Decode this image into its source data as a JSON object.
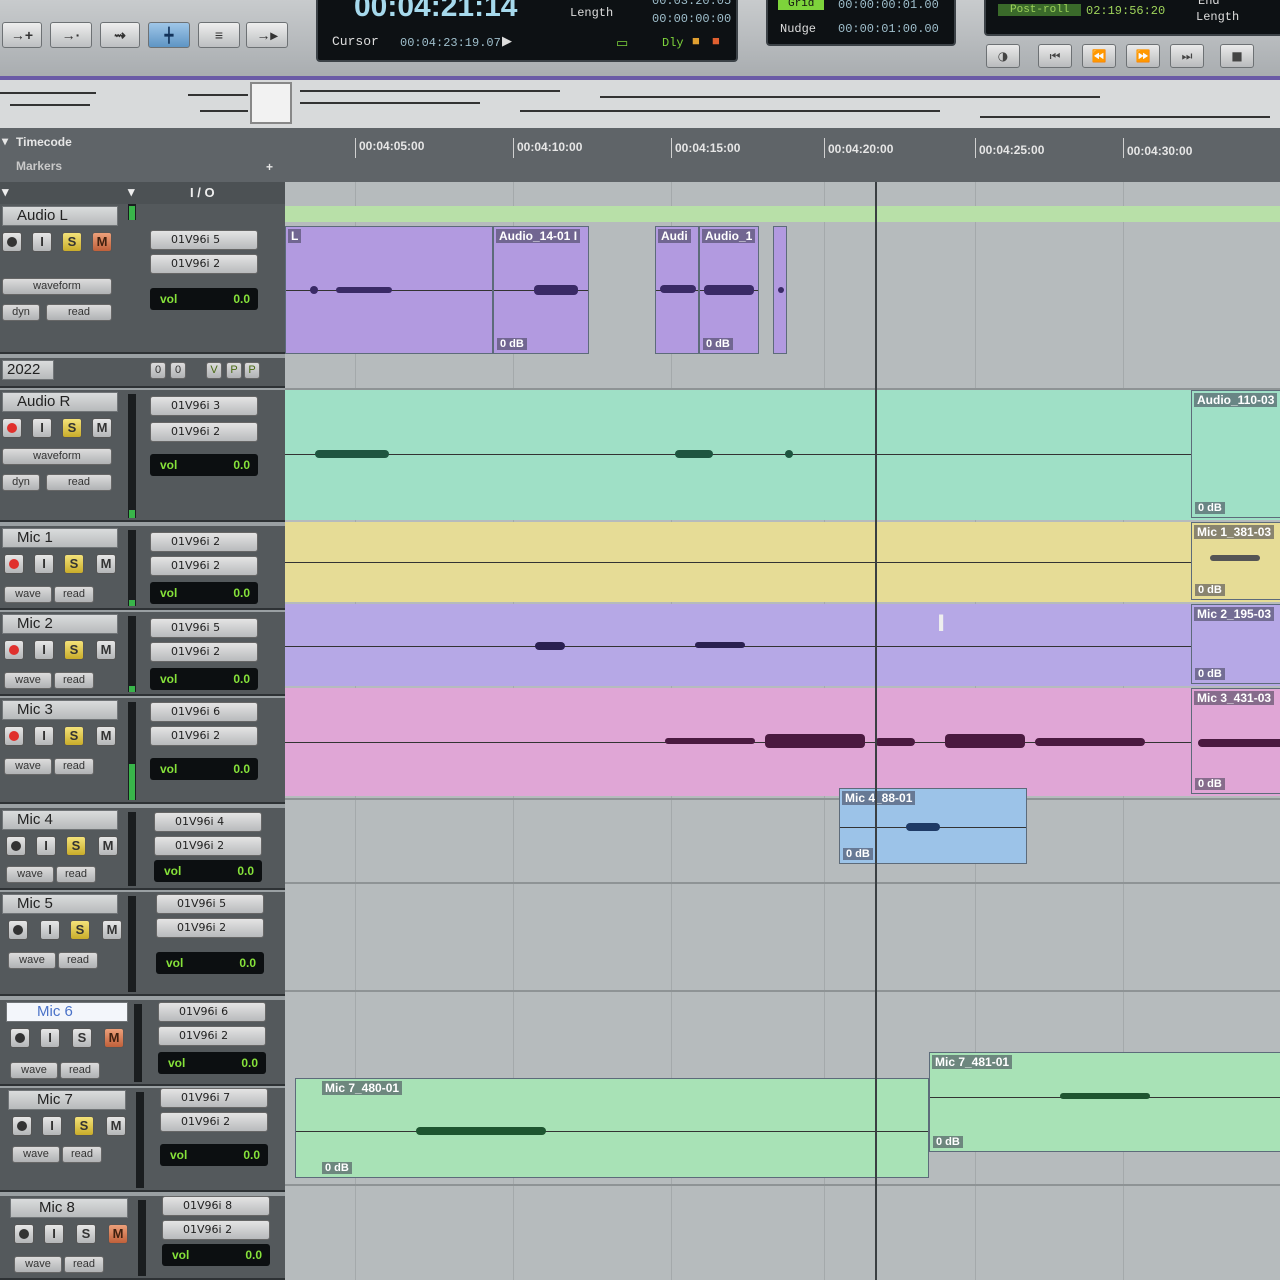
{
  "toolbar": {
    "counter": {
      "main": "00:04:21:14",
      "cursor_label": "Cursor",
      "cursor_value": "00:04:23:19.07",
      "length_label": "Length",
      "end_value": "00:03:20:05",
      "length_value": "00:00:00:00",
      "dly_label": "Dly"
    },
    "grid": {
      "label": "Grid",
      "value": "00:00:00:01.00",
      "nudge_label": "Nudge",
      "nudge_value": "00:00:01:00.00"
    },
    "session": {
      "label": "Post-roll",
      "value": "02:19:56:20",
      "end_label": "End",
      "length_label": "Length"
    }
  },
  "rulers": {
    "timecode_label": "Timecode",
    "markers_label": "Markers",
    "ticks": [
      "00:04:05:00",
      "00:04:10:00",
      "00:04:15:00",
      "00:04:20:00",
      "00:04:25:00",
      "00:04:30:00"
    ]
  },
  "headers": {
    "io": "I / O"
  },
  "tracks": [
    {
      "name": "Audio L",
      "view": "waveform",
      "dyn": "dyn",
      "auto": "read",
      "input": "01V96i 5",
      "output": "01V96i 2",
      "vol_label": "vol",
      "vol": "0.0",
      "armed": false
    },
    {
      "name": "2022",
      "extra": true
    },
    {
      "name": "Audio R",
      "view": "waveform",
      "dyn": "dyn",
      "auto": "read",
      "input": "01V96i 3",
      "output": "01V96i 2",
      "vol_label": "vol",
      "vol": "0.0",
      "armed": true
    },
    {
      "name": "Mic 1",
      "view": "wave",
      "auto": "read",
      "input": "01V96i 2",
      "output": "01V96i 2",
      "vol_label": "vol",
      "vol": "0.0",
      "armed": true
    },
    {
      "name": "Mic 2",
      "view": "wave",
      "auto": "read",
      "input": "01V96i 5",
      "output": "01V96i 2",
      "vol_label": "vol",
      "vol": "0.0",
      "armed": true
    },
    {
      "name": "Mic 3",
      "view": "wave",
      "auto": "read",
      "input": "01V96i 6",
      "output": "01V96i 2",
      "vol_label": "vol",
      "vol": "0.0",
      "armed": true
    },
    {
      "name": "Mic 4",
      "view": "wave",
      "auto": "read",
      "input": "01V96i 4",
      "output": "01V96i 2",
      "vol_label": "vol",
      "vol": "0.0",
      "armed": false
    },
    {
      "name": "Mic 5",
      "view": "wave",
      "auto": "read",
      "input": "01V96i 5",
      "output": "01V96i 2",
      "vol_label": "vol",
      "vol": "0.0",
      "armed": false
    },
    {
      "name": "Mic 6",
      "view": "wave",
      "auto": "read",
      "input": "01V96i 6",
      "output": "01V96i 2",
      "vol_label": "vol",
      "vol": "0.0",
      "armed": false
    },
    {
      "name": "Mic 7",
      "view": "wave",
      "auto": "read",
      "input": "01V96i 7",
      "output": "01V96i 2",
      "vol_label": "vol",
      "vol": "0.0",
      "armed": false
    },
    {
      "name": "Mic 8",
      "view": "wave",
      "auto": "read",
      "input": "01V96i 8",
      "output": "01V96i 2",
      "vol_label": "vol",
      "vol": "0.0",
      "armed": false
    }
  ],
  "extra_row": {
    "a": "0",
    "b": "0",
    "v": "V",
    "p1": "P",
    "p2": "P"
  },
  "clips": {
    "audio_l_1": {
      "name": "L",
      "gain": ""
    },
    "audio_l_2": {
      "name": "Audio_14-01 I",
      "gain": "0 dB"
    },
    "audio_l_3": {
      "name": "Audi",
      "gain": ""
    },
    "audio_l_4": {
      "name": "Audio_1",
      "gain": "0 dB"
    },
    "audio_r_end": {
      "name": "Audio_110-03",
      "gain": "0 dB"
    },
    "mic1_end": {
      "name": "Mic 1_381-03",
      "gain": "0 dB"
    },
    "mic2_end": {
      "name": "Mic 2_195-03",
      "gain": "0 dB"
    },
    "mic3_end": {
      "name": "Mic 3_431-03",
      "gain": "0 dB"
    },
    "mic4": {
      "name": "Mic 4_88-01",
      "gain": "0 dB"
    },
    "mic7_1": {
      "name": "Mic 7_480-01",
      "gain": "0 dB"
    },
    "mic7_2": {
      "name": "Mic 7_481-01",
      "gain": "0 dB"
    }
  },
  "colors": {
    "purple": "#b29ae0",
    "teal": "#9fe0c6",
    "yellow": "#e6dc96",
    "lavender": "#b6a8e6",
    "pink": "#e0a6d6",
    "blue": "#9cc3e8",
    "green": "#a8e2b6"
  }
}
